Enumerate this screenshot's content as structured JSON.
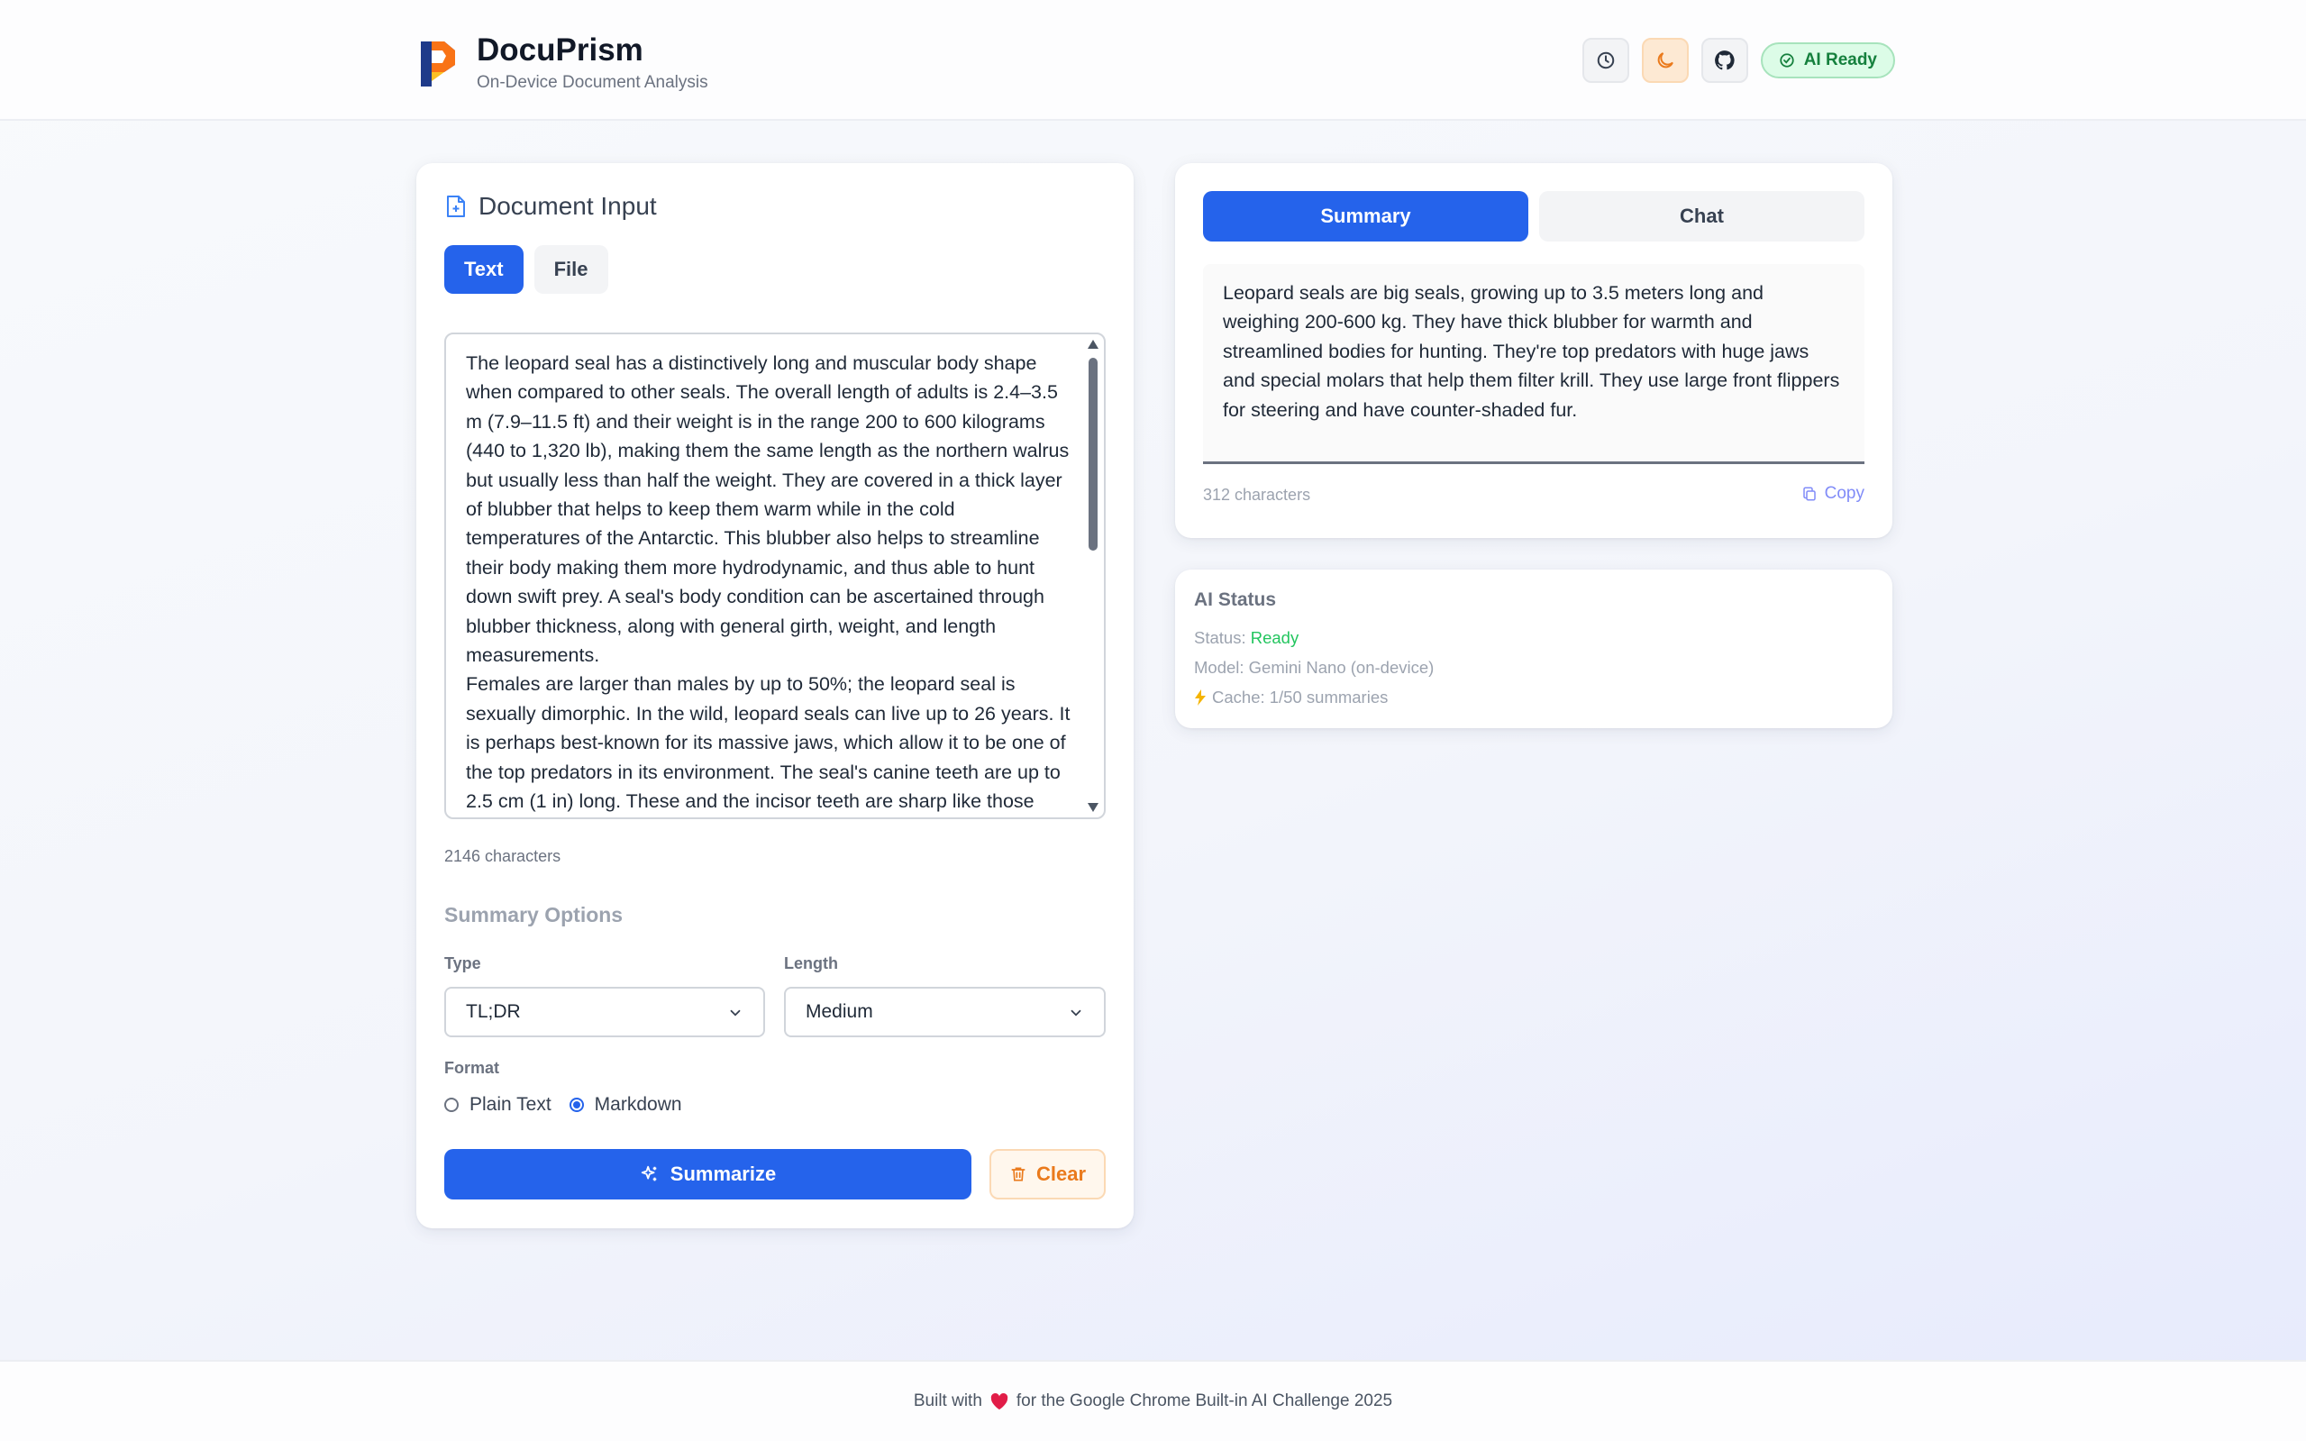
{
  "header": {
    "app_name": "DocuPrism",
    "subtitle": "On-Device Document Analysis",
    "actions": [
      {
        "icon": "clock-icon"
      },
      {
        "icon": "moon-icon"
      },
      {
        "icon": "github-icon"
      }
    ],
    "ai_badge": "AI Ready"
  },
  "input_panel": {
    "title": "Document Input",
    "title_icon": "file-plus-icon",
    "tabs": [
      "Text",
      "File"
    ],
    "active_tab": "Text",
    "text": "The leopard seal has a distinctively long and muscular body shape when compared to other seals. The overall length of adults is 2.4–3.5 m (7.9–11.5 ft) and their weight is in the range 200 to 600 kilograms (440 to 1,320 lb), making them the same length as the northern walrus but usually less than half the weight. They are covered in a thick layer of blubber that helps to keep them warm while in the cold temperatures of the Antarctic. This blubber also helps to streamline their body making them more hydrodynamic, and thus able to hunt down swift prey. A seal's body condition can be ascertained through blubber thickness, along with general girth, weight, and length measurements.\nFemales are larger than males by up to 50%; the leopard seal is sexually dimorphic. In the wild, leopard seals can live up to 26 years. It is perhaps best-known for its massive jaws, which allow it to be one of the top predators in its environment. The seal's canine teeth are up to 2.5 cm (1 in) long. These and the incisor teeth are sharp like those",
    "char_count": "2146 characters",
    "options_title": "Summary Options",
    "type_label": "Type",
    "type_value": "TL;DR",
    "length_label": "Length",
    "length_value": "Medium",
    "format_label": "Format",
    "format_options": [
      "Plain Text",
      "Markdown"
    ],
    "format_selected": "Markdown",
    "summarize_label": "Summarize",
    "clear_label": "Clear"
  },
  "summary_panel": {
    "tabs": [
      "Summary",
      "Chat"
    ],
    "active_tab": "Summary",
    "summary_text": "Leopard seals are big seals, growing up to 3.5 meters long and weighing 200-600 kg. They have thick blubber for warmth and streamlined bodies for hunting. They're top predators with huge jaws and special molars that help them filter krill. They use large front flippers for steering and have counter-shaded fur.",
    "char_count": "312 characters",
    "copy_label": "Copy"
  },
  "ai_status": {
    "title": "AI Status",
    "status_label": "Status: ",
    "status_value": "Ready",
    "model": "Model: Gemini Nano (on-device)",
    "cache": "Cache: 1/50 summaries"
  },
  "footer": {
    "text_before": "Built with",
    "text_after": "for the Google Chrome Built-in AI Challenge 2025"
  },
  "colors": {
    "primary": "#2563eb",
    "success": "#22c55e",
    "warning": "#ea7a1c",
    "heart": "#e11d48"
  }
}
